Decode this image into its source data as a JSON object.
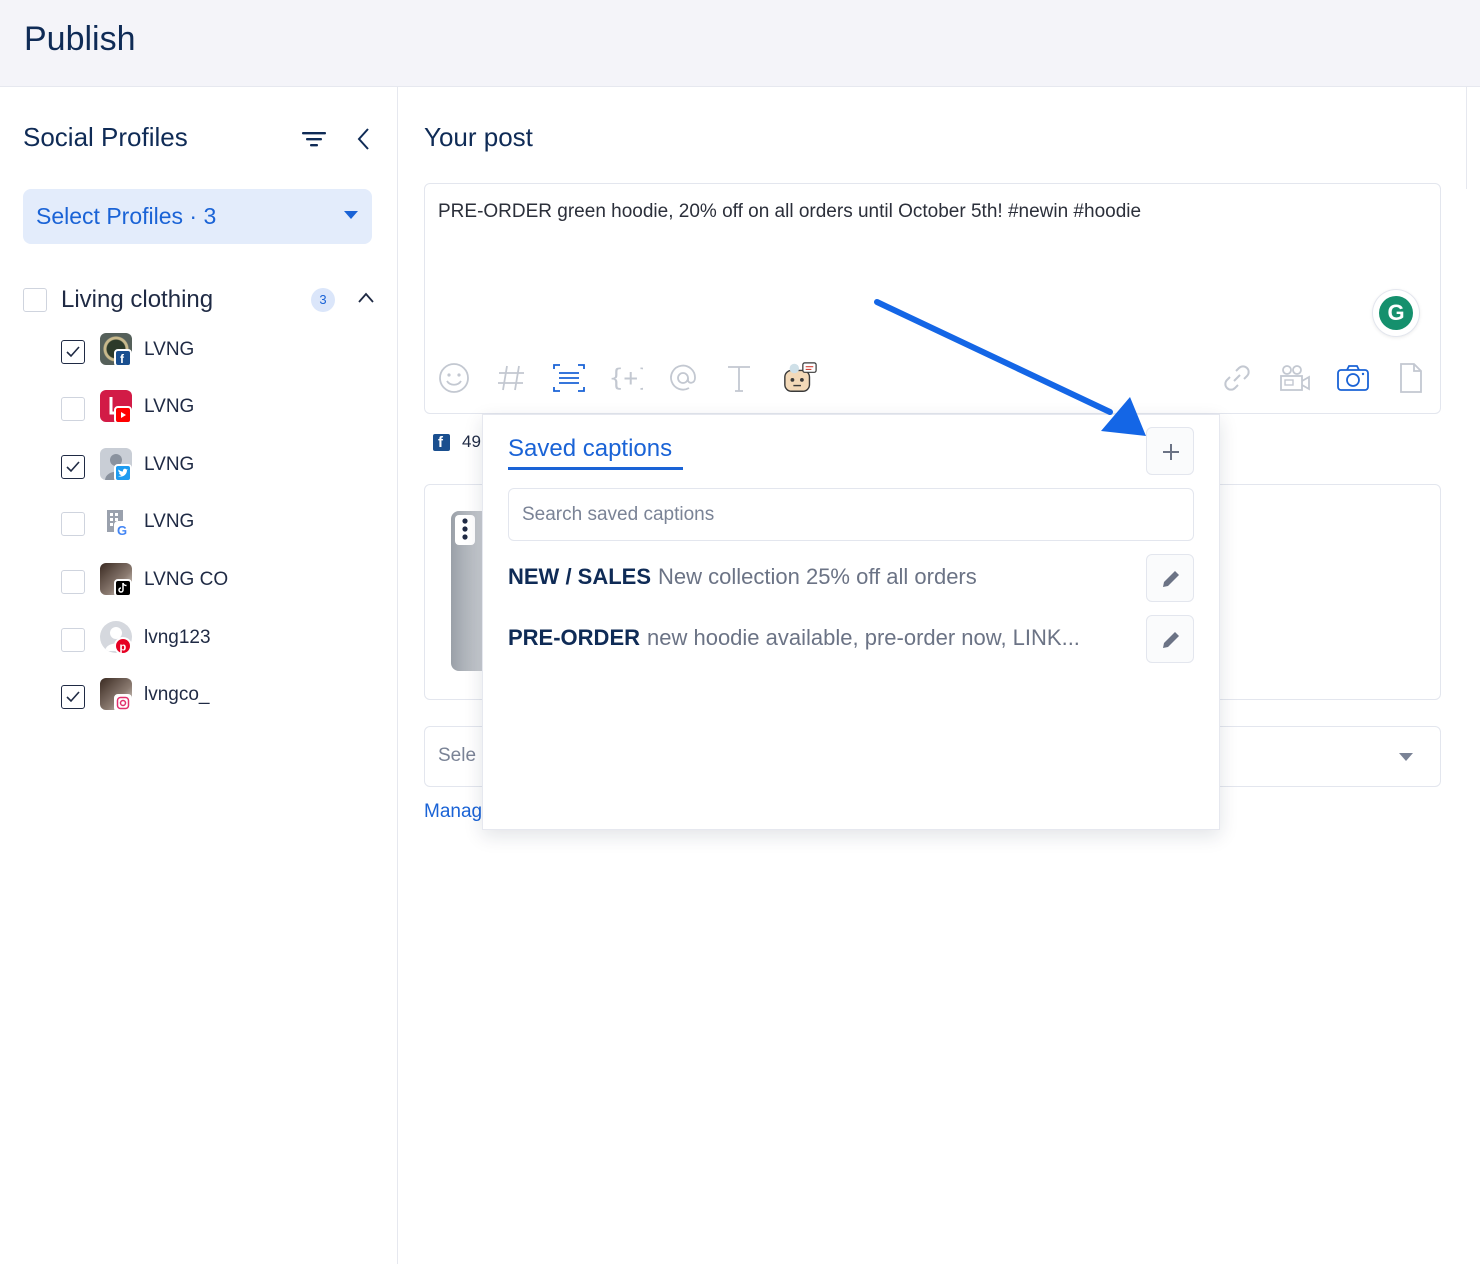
{
  "header": {
    "title": "Publish"
  },
  "sidebar": {
    "title": "Social Profiles",
    "select_profiles_label": "Select Profiles · 3",
    "group": {
      "name": "Living clothing",
      "count": "3"
    },
    "profiles": [
      {
        "name": "LVNG",
        "network": "facebook",
        "checked": true
      },
      {
        "name": "LVNG",
        "network": "youtube",
        "checked": false
      },
      {
        "name": "LVNG",
        "network": "twitter",
        "checked": true
      },
      {
        "name": "LVNG",
        "network": "google",
        "checked": false
      },
      {
        "name": "LVNG CO",
        "network": "tiktok",
        "checked": false
      },
      {
        "name": "lvng123",
        "network": "pinterest",
        "checked": false
      },
      {
        "name": "lvngco_",
        "network": "instagram",
        "checked": true
      }
    ]
  },
  "main": {
    "title": "Your post",
    "post_text": "PRE-ORDER green hoodie, 20% off on all orders until October 5th! #newin #hoodie",
    "grammarly_letter": "G",
    "facebook_count": "49",
    "select_placeholder": "Sele",
    "manage_link": "Manag"
  },
  "popup": {
    "tab_label": "Saved captions",
    "search_placeholder": "Search saved captions",
    "captions": [
      {
        "title": "NEW / SALES",
        "text": "New collection 25% off all orders"
      },
      {
        "title": "PRE-ORDER",
        "text": "new hoodie available, pre-order now, LINK..."
      }
    ]
  },
  "colors": {
    "accent": "#1a63d6",
    "heading": "#0f2b56",
    "arrow": "#1466e6"
  }
}
